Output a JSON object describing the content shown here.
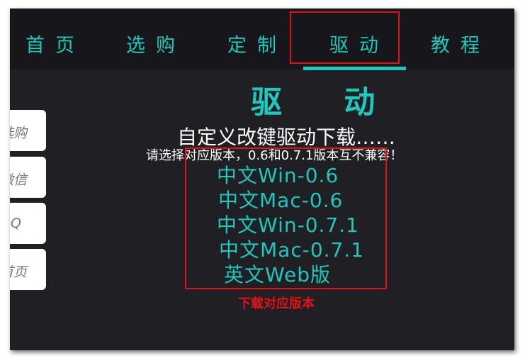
{
  "nav": {
    "items": [
      {
        "label": "首页"
      },
      {
        "label": "选购"
      },
      {
        "label": "定制"
      },
      {
        "label": "驱动"
      },
      {
        "label": "教程"
      }
    ],
    "active": "驱动"
  },
  "sidebar": {
    "tabs": [
      {
        "label": "选购"
      },
      {
        "label": "微信"
      },
      {
        "label": "QQ"
      },
      {
        "label": "首页"
      }
    ]
  },
  "main": {
    "title": "驱 动",
    "subtitle": "自定义改键驱动下载……",
    "note": "请选择对应版本，0.6和0.7.1版本互不兼容！",
    "downloads": [
      {
        "label": "中文Win-0.6"
      },
      {
        "label": "中文Mac-0.6"
      },
      {
        "label": "中文Win-0.7.1"
      },
      {
        "label": "中文Mac-0.7.1"
      },
      {
        "label": "英文Web版"
      }
    ]
  },
  "annotation": {
    "label": "下载对应版本",
    "color": "#e01414"
  },
  "colors": {
    "accent": "#1fc7bd",
    "background": "#1f1f24",
    "nav_background": "#17171b"
  }
}
